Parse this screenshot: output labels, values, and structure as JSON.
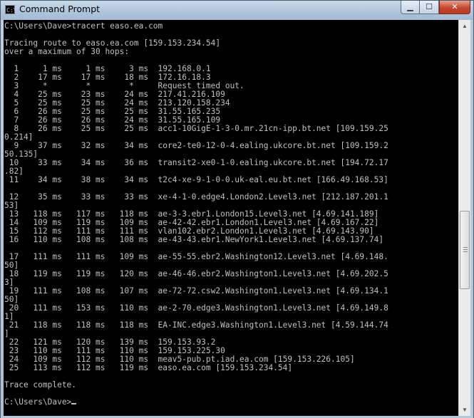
{
  "window": {
    "title": "Command Prompt",
    "app_icon": "C:\\",
    "controls": {
      "minimize": "▁",
      "maximize": "☐",
      "close": "✕"
    }
  },
  "console": {
    "lines": [
      "C:\\Users\\Dave>tracert easo.ea.com",
      "",
      "Tracing route to easo.ea.com [159.153.234.54]",
      "over a maximum of 30 hops:",
      "",
      "  1     1 ms     1 ms     3 ms  192.168.0.1",
      "  2    17 ms    17 ms    18 ms  172.16.18.3",
      "  3     *        *        *     Request timed out.",
      "  4    25 ms    23 ms    24 ms  217.41.216.109",
      "  5    25 ms    25 ms    24 ms  213.120.158.234",
      "  6    26 ms    25 ms    25 ms  31.55.165.235",
      "  7    26 ms    26 ms    24 ms  31.55.165.109",
      "  8    26 ms    25 ms    25 ms  acc1-10GigE-1-3-0.mr.21cn-ipp.bt.net [109.159.25",
      "0.214]",
      "  9    37 ms    32 ms    34 ms  core2-te0-12-0-4.ealing.ukcore.bt.net [109.159.2",
      "50.135]",
      " 10    33 ms    34 ms    36 ms  transit2-xe0-1-0.ealing.ukcore.bt.net [194.72.17",
      ".82]",
      " 11    34 ms    38 ms    34 ms  t2c4-xe-9-1-0-0.uk-eal.eu.bt.net [166.49.168.53]",
      "",
      " 12    35 ms    33 ms    33 ms  xe-4-1-0.edge4.London2.Level3.net [212.187.201.1",
      "53]",
      " 13   118 ms   117 ms   118 ms  ae-3-3.ebr1.London15.Level3.net [4.69.141.189]",
      " 14   109 ms   119 ms   109 ms  ae-42-42.ebr1.London1.Level3.net [4.69.167.22]",
      " 15   112 ms   111 ms   111 ms  vlan102.ebr2.London1.Level3.net [4.69.143.90]",
      " 16   110 ms   108 ms   108 ms  ae-43-43.ebr1.NewYork1.Level3.net [4.69.137.74]",
      "",
      " 17   111 ms   111 ms   109 ms  ae-55-55.ebr2.Washington12.Level3.net [4.69.148.",
      "50]",
      " 18   119 ms   119 ms   120 ms  ae-46-46.ebr2.Washington1.Level3.net [4.69.202.5",
      "3]",
      " 19   111 ms   108 ms   107 ms  ae-72-72.csw2.Washington1.Level3.net [4.69.134.1",
      "50]",
      " 20   111 ms   153 ms   110 ms  ae-2-70.edge3.Washington1.Level3.net [4.69.149.8",
      "1]",
      " 21   118 ms   118 ms   118 ms  EA-INC.edge3.Washington1.Level3.net [4.59.144.74",
      "]",
      " 22   121 ms   120 ms   139 ms  159.153.93.2",
      " 23   110 ms   111 ms   110 ms  159.153.225.30",
      " 24   109 ms   112 ms   110 ms  meav5-pub.pt.iad.ea.com [159.153.226.105]",
      " 25   113 ms   112 ms   119 ms  easo.ea.com [159.153.234.54]",
      "",
      "Trace complete.",
      "",
      "C:\\Users\\Dave>"
    ]
  },
  "scrollbar": {
    "up_arrow": "▲",
    "down_arrow": "▼"
  }
}
